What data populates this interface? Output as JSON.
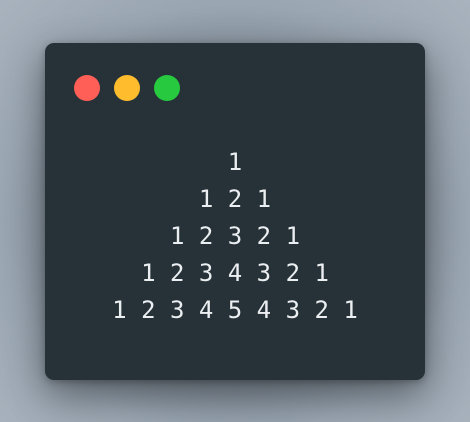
{
  "window": {
    "controls": [
      {
        "name": "close",
        "color": "#ff5f56"
      },
      {
        "name": "minimize",
        "color": "#ffbd2e"
      },
      {
        "name": "zoom",
        "color": "#27c93f"
      }
    ]
  },
  "terminal": {
    "lines": [
      "1",
      "1 2 1",
      "1 2 3 2 1",
      "1 2 3 4 3 2 1",
      "1 2 3 4 5 4 3 2 1"
    ]
  }
}
